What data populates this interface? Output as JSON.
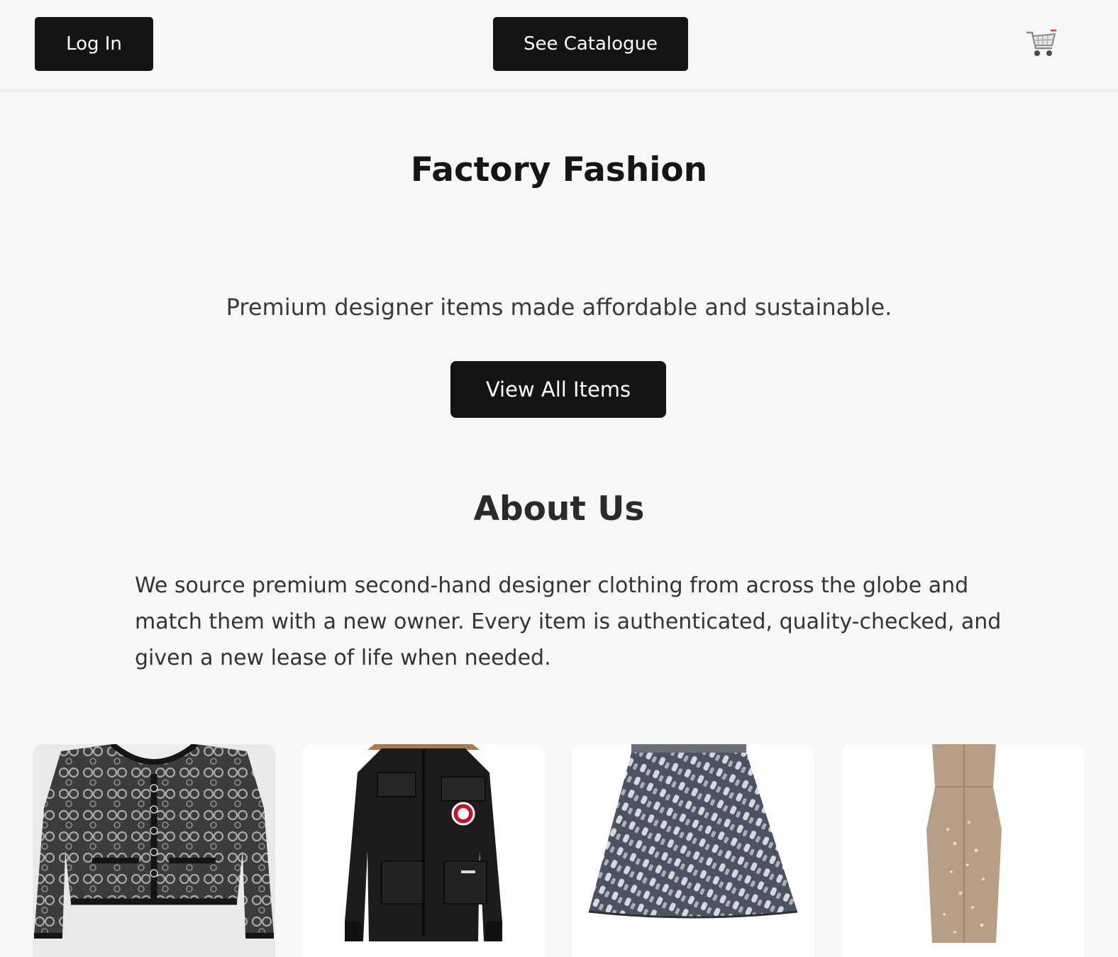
{
  "header": {
    "login_label": "Log In",
    "catalogue_label": "See Catalogue",
    "cart_icon": "shopping-cart-icon"
  },
  "hero": {
    "title": "Factory Fashion",
    "tagline": "Premium designer items made affordable and sustainable.",
    "cta_label": "View All Items"
  },
  "about": {
    "heading": "About Us",
    "body": "We source premium second-hand designer clothing from across the globe and match them with a new owner. Every item is authenticated, quality-checked, and given a new lease of life when needed."
  },
  "products": [
    {
      "image": "tweed-cropped-jacket-image"
    },
    {
      "image": "black-parka-image"
    },
    {
      "image": "monogram-mini-skirt-image"
    },
    {
      "image": "sequin-gown-image"
    }
  ],
  "colors": {
    "background": "#f7f7f5",
    "button": "#141414",
    "button_text": "#ffffff"
  }
}
